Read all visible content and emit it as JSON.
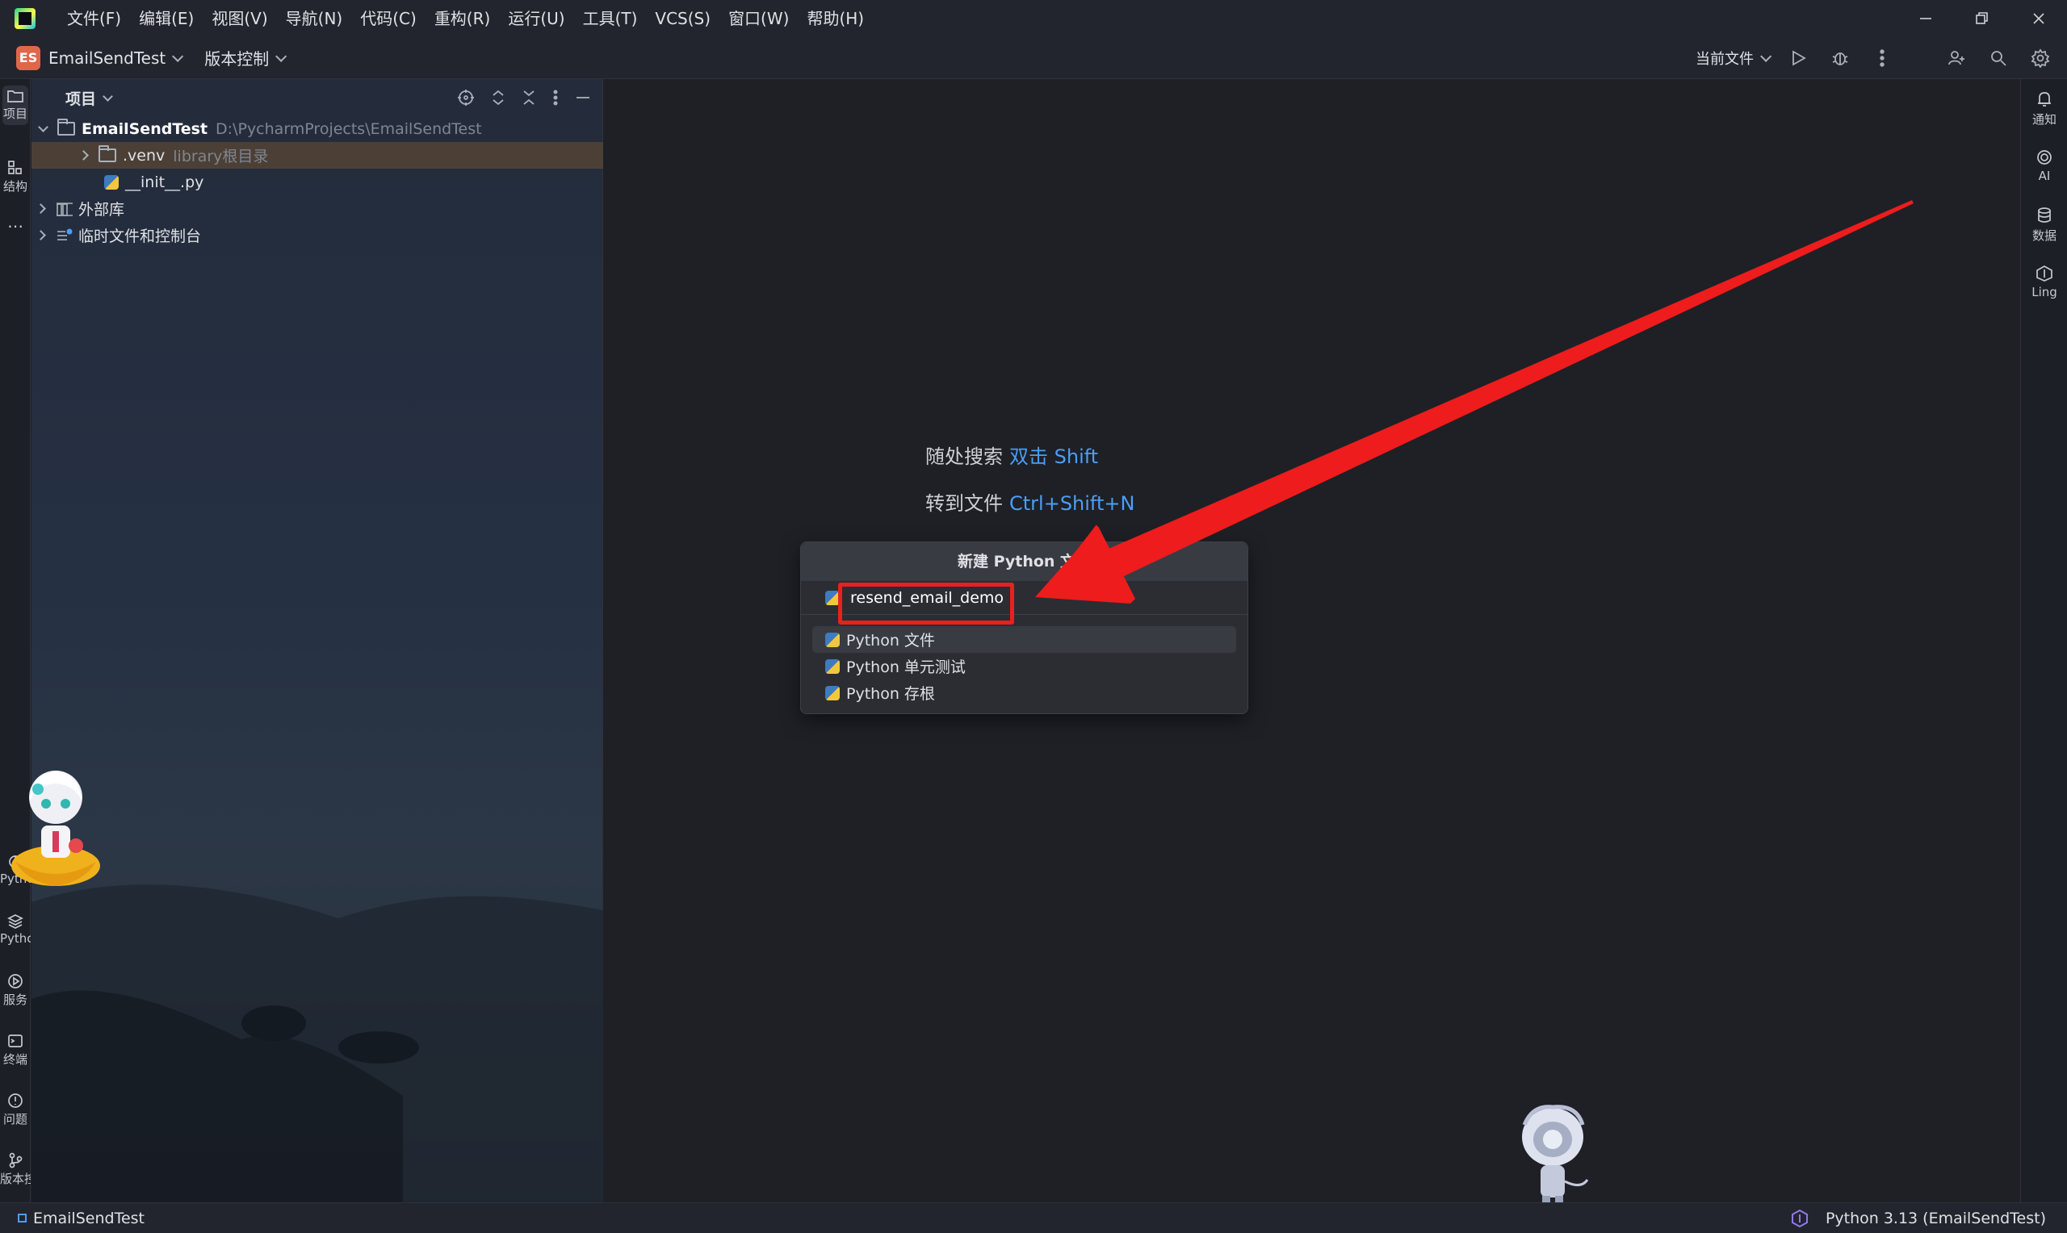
{
  "menu": {
    "items": [
      "文件(F)",
      "编辑(E)",
      "视图(V)",
      "导航(N)",
      "代码(C)",
      "重构(R)",
      "运行(U)",
      "工具(T)",
      "VCS(S)",
      "窗口(W)",
      "帮助(H)"
    ]
  },
  "toolbar": {
    "project_badge": "ES",
    "project_name": "EmailSendTest",
    "vcs_label": "版本控制",
    "run_config": "当前文件"
  },
  "left_stripe": {
    "project": "项目",
    "structure": "结构",
    "more": "⋯",
    "python_console": "Pytho",
    "python_packages": "Pytho",
    "services": "服务",
    "terminal": "终端",
    "problems": "问题",
    "vcs": "版本控"
  },
  "project_panel": {
    "title": "项目",
    "tree": {
      "root_name": "EmailSendTest",
      "root_path": "D:\\PycharmProjects\\EmailSendTest",
      "venv_name": ".venv",
      "venv_hint": "library根目录",
      "init_file": "__init__.py",
      "external_libs": "外部库",
      "scratches": "临时文件和控制台"
    }
  },
  "editor": {
    "search_label": "随处搜索",
    "search_shortcut": "双击 Shift",
    "goto_label": "转到文件",
    "goto_shortcut": "Ctrl+Shift+N"
  },
  "popup": {
    "title": "新建 Python 文件",
    "input_value": "resend_email_demo",
    "options": [
      "Python 文件",
      "Python 单元测试",
      "Python 存根"
    ]
  },
  "right_stripe": {
    "notifications": "通知",
    "ai": "AI",
    "database": "数据",
    "lingma": "Ling"
  },
  "statusbar": {
    "project": "EmailSendTest",
    "interpreter": "Python 3.13 (EmailSendTest)"
  },
  "colors": {
    "accent_link": "#4b9ef5",
    "highlight_red": "#e8211f",
    "project_badge": "#e0664b"
  }
}
